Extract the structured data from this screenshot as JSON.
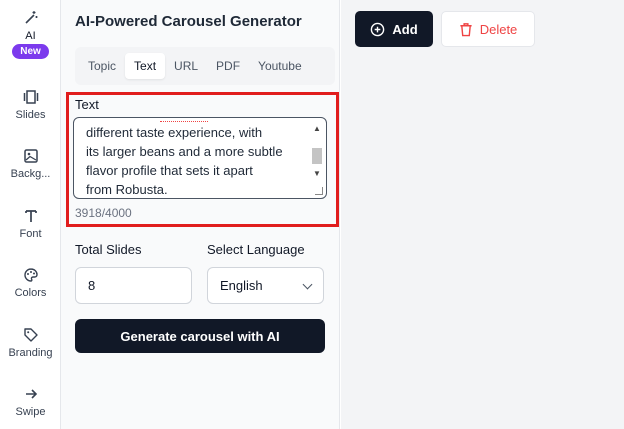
{
  "rail": {
    "items": [
      {
        "label": "AI",
        "badge": "New",
        "icon": "magic-wand-icon"
      },
      {
        "label": "Slides",
        "icon": "slides-icon"
      },
      {
        "label": "Backg...",
        "icon": "image-icon"
      },
      {
        "label": "Font",
        "icon": "text-t-icon"
      },
      {
        "label": "Colors",
        "icon": "palette-icon"
      },
      {
        "label": "Branding",
        "icon": "tag-icon"
      },
      {
        "label": "Swipe",
        "icon": "arrow-right-icon"
      }
    ]
  },
  "panel": {
    "title": "AI-Powered Carousel Generator",
    "tabs": [
      "Topic",
      "Text",
      "URL",
      "PDF",
      "Youtube"
    ],
    "active_tab": "Text",
    "text_label": "Text",
    "text_value": "different taste experience, with\nits larger beans and a more subtle\nflavor profile that sets it apart\nfrom Robusta.",
    "counter": "3918/4000",
    "total_slides_label": "Total Slides",
    "total_slides_value": "8",
    "language_label": "Select Language",
    "language_value": "English",
    "generate_label": "Generate carousel with AI"
  },
  "toolbar": {
    "add_label": "Add",
    "delete_label": "Delete"
  },
  "colors": {
    "primary_dark": "#111827",
    "badge_purple": "#7c3aed",
    "delete_red": "#ef4444",
    "highlight_red": "#e11d1d"
  }
}
